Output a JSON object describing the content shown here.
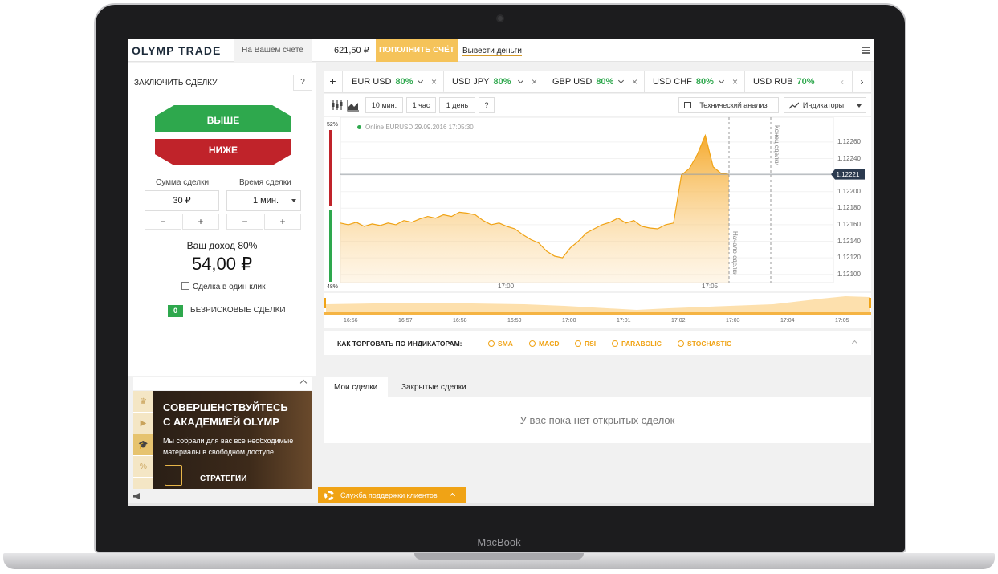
{
  "device": {
    "brand": "MacBook"
  },
  "header": {
    "logo": "OLYMP TRADE",
    "account_label": "На Вашем счёте",
    "balance": "621,50 ₽",
    "deposit_label": "ПОПОЛНИТЬ СЧЁТ",
    "withdraw_label": "Вывести деньги"
  },
  "trade_panel": {
    "title": "ЗАКЛЮЧИТЬ СДЕЛКУ",
    "help": "?",
    "up_label": "ВЫШЕ",
    "down_label": "НИЖЕ",
    "amount_label": "Сумма сделки",
    "time_label": "Время сделки",
    "amount_value": "30 ₽",
    "time_value": "1 мин.",
    "minus": "−",
    "plus": "+",
    "income_label": "Ваш доход 80%",
    "income_value": "54,00 ₽",
    "one_click_label": "Сделка в один клик",
    "risk_free_count": "0",
    "risk_free_label": "БЕЗРИСКОВЫЕ СДЕЛКИ"
  },
  "promo": {
    "heading_line1": "СОВЕРШЕНСТВУЙТЕСЬ",
    "heading_line2": "С АКАДЕМИЕЙ OLYMP",
    "text": "Мы собрали для вас все необходимые материалы в свободном доступе",
    "link": "СТРАТЕГИИ",
    "side_icons": [
      "crown-icon",
      "play-icon",
      "graduation-cap-icon",
      "percent-icon"
    ]
  },
  "asset_tabs": {
    "add": "+",
    "items": [
      {
        "name": "EUR USD",
        "pct": "80%"
      },
      {
        "name": "USD JPY",
        "pct": "80%"
      },
      {
        "name": "GBP USD",
        "pct": "80%"
      },
      {
        "name": "USD CHF",
        "pct": "80%"
      },
      {
        "name": "USD RUB",
        "pct": "70%"
      }
    ],
    "close": "×",
    "prev": "‹",
    "next": "›"
  },
  "toolbar": {
    "intervals": [
      "10 мин.",
      "1 час",
      "1 день"
    ],
    "help": "?",
    "tech_analysis": "Технический анализ",
    "indicators": "Индикаторы"
  },
  "chart": {
    "online_label": "Online EURUSD 29.09.2016 17:05:30",
    "pct_top": "52%",
    "pct_bottom": "48%",
    "current_price": "1.12221",
    "deal_end_label": "Конец сделки",
    "deal_start_label": "Начало сделки",
    "accent": "#f5a623"
  },
  "chart_data": {
    "type": "area",
    "x_ticks": [
      "17:00",
      "17:05"
    ],
    "y_ticks": [
      "1.12260",
      "1.12240",
      "1.12220",
      "1.12200",
      "1.12180",
      "1.12160",
      "1.12140",
      "1.12120",
      "1.12100"
    ],
    "ylim": [
      1.1209,
      1.1229
    ],
    "current": 1.12221,
    "series": [
      {
        "values": [
          1.12162,
          1.1216,
          1.12163,
          1.12158,
          1.12161,
          1.12159,
          1.12162,
          1.1216,
          1.12165,
          1.12163,
          1.12167,
          1.1217,
          1.12168,
          1.12172,
          1.1217,
          1.12175,
          1.12174,
          1.12172,
          1.12165,
          1.1216,
          1.12162,
          1.12158,
          1.12155,
          1.12148,
          1.12142,
          1.12138,
          1.12128,
          1.12122,
          1.1212,
          1.12132,
          1.1214,
          1.1215,
          1.12155,
          1.1216,
          1.12163,
          1.12168,
          1.12162,
          1.12165,
          1.12158,
          1.12156,
          1.12155,
          1.1216,
          1.12162,
          1.1222,
          1.12228,
          1.12245,
          1.12268,
          1.1223,
          1.12222,
          1.12221
        ]
      }
    ]
  },
  "navigator": {
    "ticks": [
      "16:56",
      "16:57",
      "16:58",
      "16:59",
      "17:00",
      "17:01",
      "17:02",
      "17:03",
      "17:04",
      "17:05"
    ]
  },
  "indicators_strip": {
    "title": "КАК ТОРГОВАТЬ ПО ИНДИКАТОРАМ:",
    "items": [
      "SMA",
      "MACD",
      "RSI",
      "PARABOLIC",
      "STOCHASTIC"
    ]
  },
  "deals": {
    "tabs": [
      "Мои сделки",
      "Закрытые сделки"
    ],
    "empty": "У вас пока нет открытых сделок"
  },
  "support": {
    "label": "Служба поддержки клиентов"
  }
}
